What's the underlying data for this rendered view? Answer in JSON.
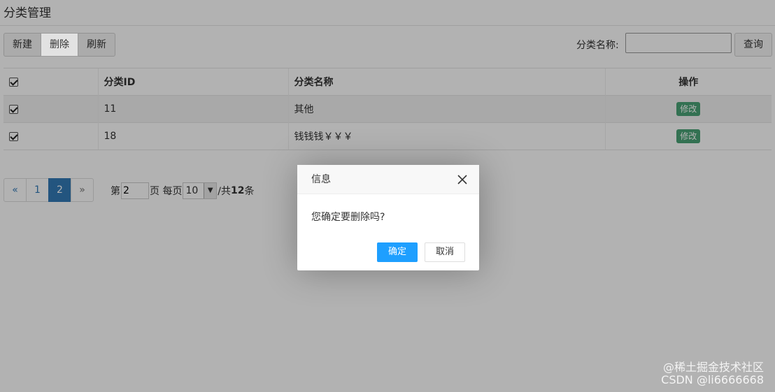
{
  "header": {
    "title": "分类管理"
  },
  "toolbar": {
    "buttons": [
      {
        "label": "新建"
      },
      {
        "label": "删除"
      },
      {
        "label": "刷新"
      }
    ],
    "search_label": "分类名称:",
    "search_value": "",
    "query_label": "查询"
  },
  "table": {
    "columns": [
      "分类ID",
      "分类名称",
      "操作"
    ],
    "rows": [
      {
        "id": "11",
        "name": "其他",
        "action": "修改"
      },
      {
        "id": "18",
        "name": "钱钱钱￥￥￥",
        "action": "修改"
      }
    ]
  },
  "pagination": {
    "prev": "«",
    "pages": [
      "1",
      "2"
    ],
    "current": "2",
    "next": "»",
    "label_page_prefix": "第",
    "page_value": "2",
    "label_page_suffix": "页 每页",
    "page_size": "10",
    "total_prefix": "/共",
    "total_count": "12",
    "total_suffix": "条"
  },
  "dialog": {
    "title": "信息",
    "message": "您确定要删除吗?",
    "confirm": "确定",
    "cancel": "取消"
  },
  "watermark": {
    "line1": "@稀土掘金技术社区",
    "line2": "CSDN @li6666668"
  },
  "colors": {
    "primary_button": "#1e9fff",
    "current_page": "#337ab7",
    "edit_button": "#4aa376"
  }
}
